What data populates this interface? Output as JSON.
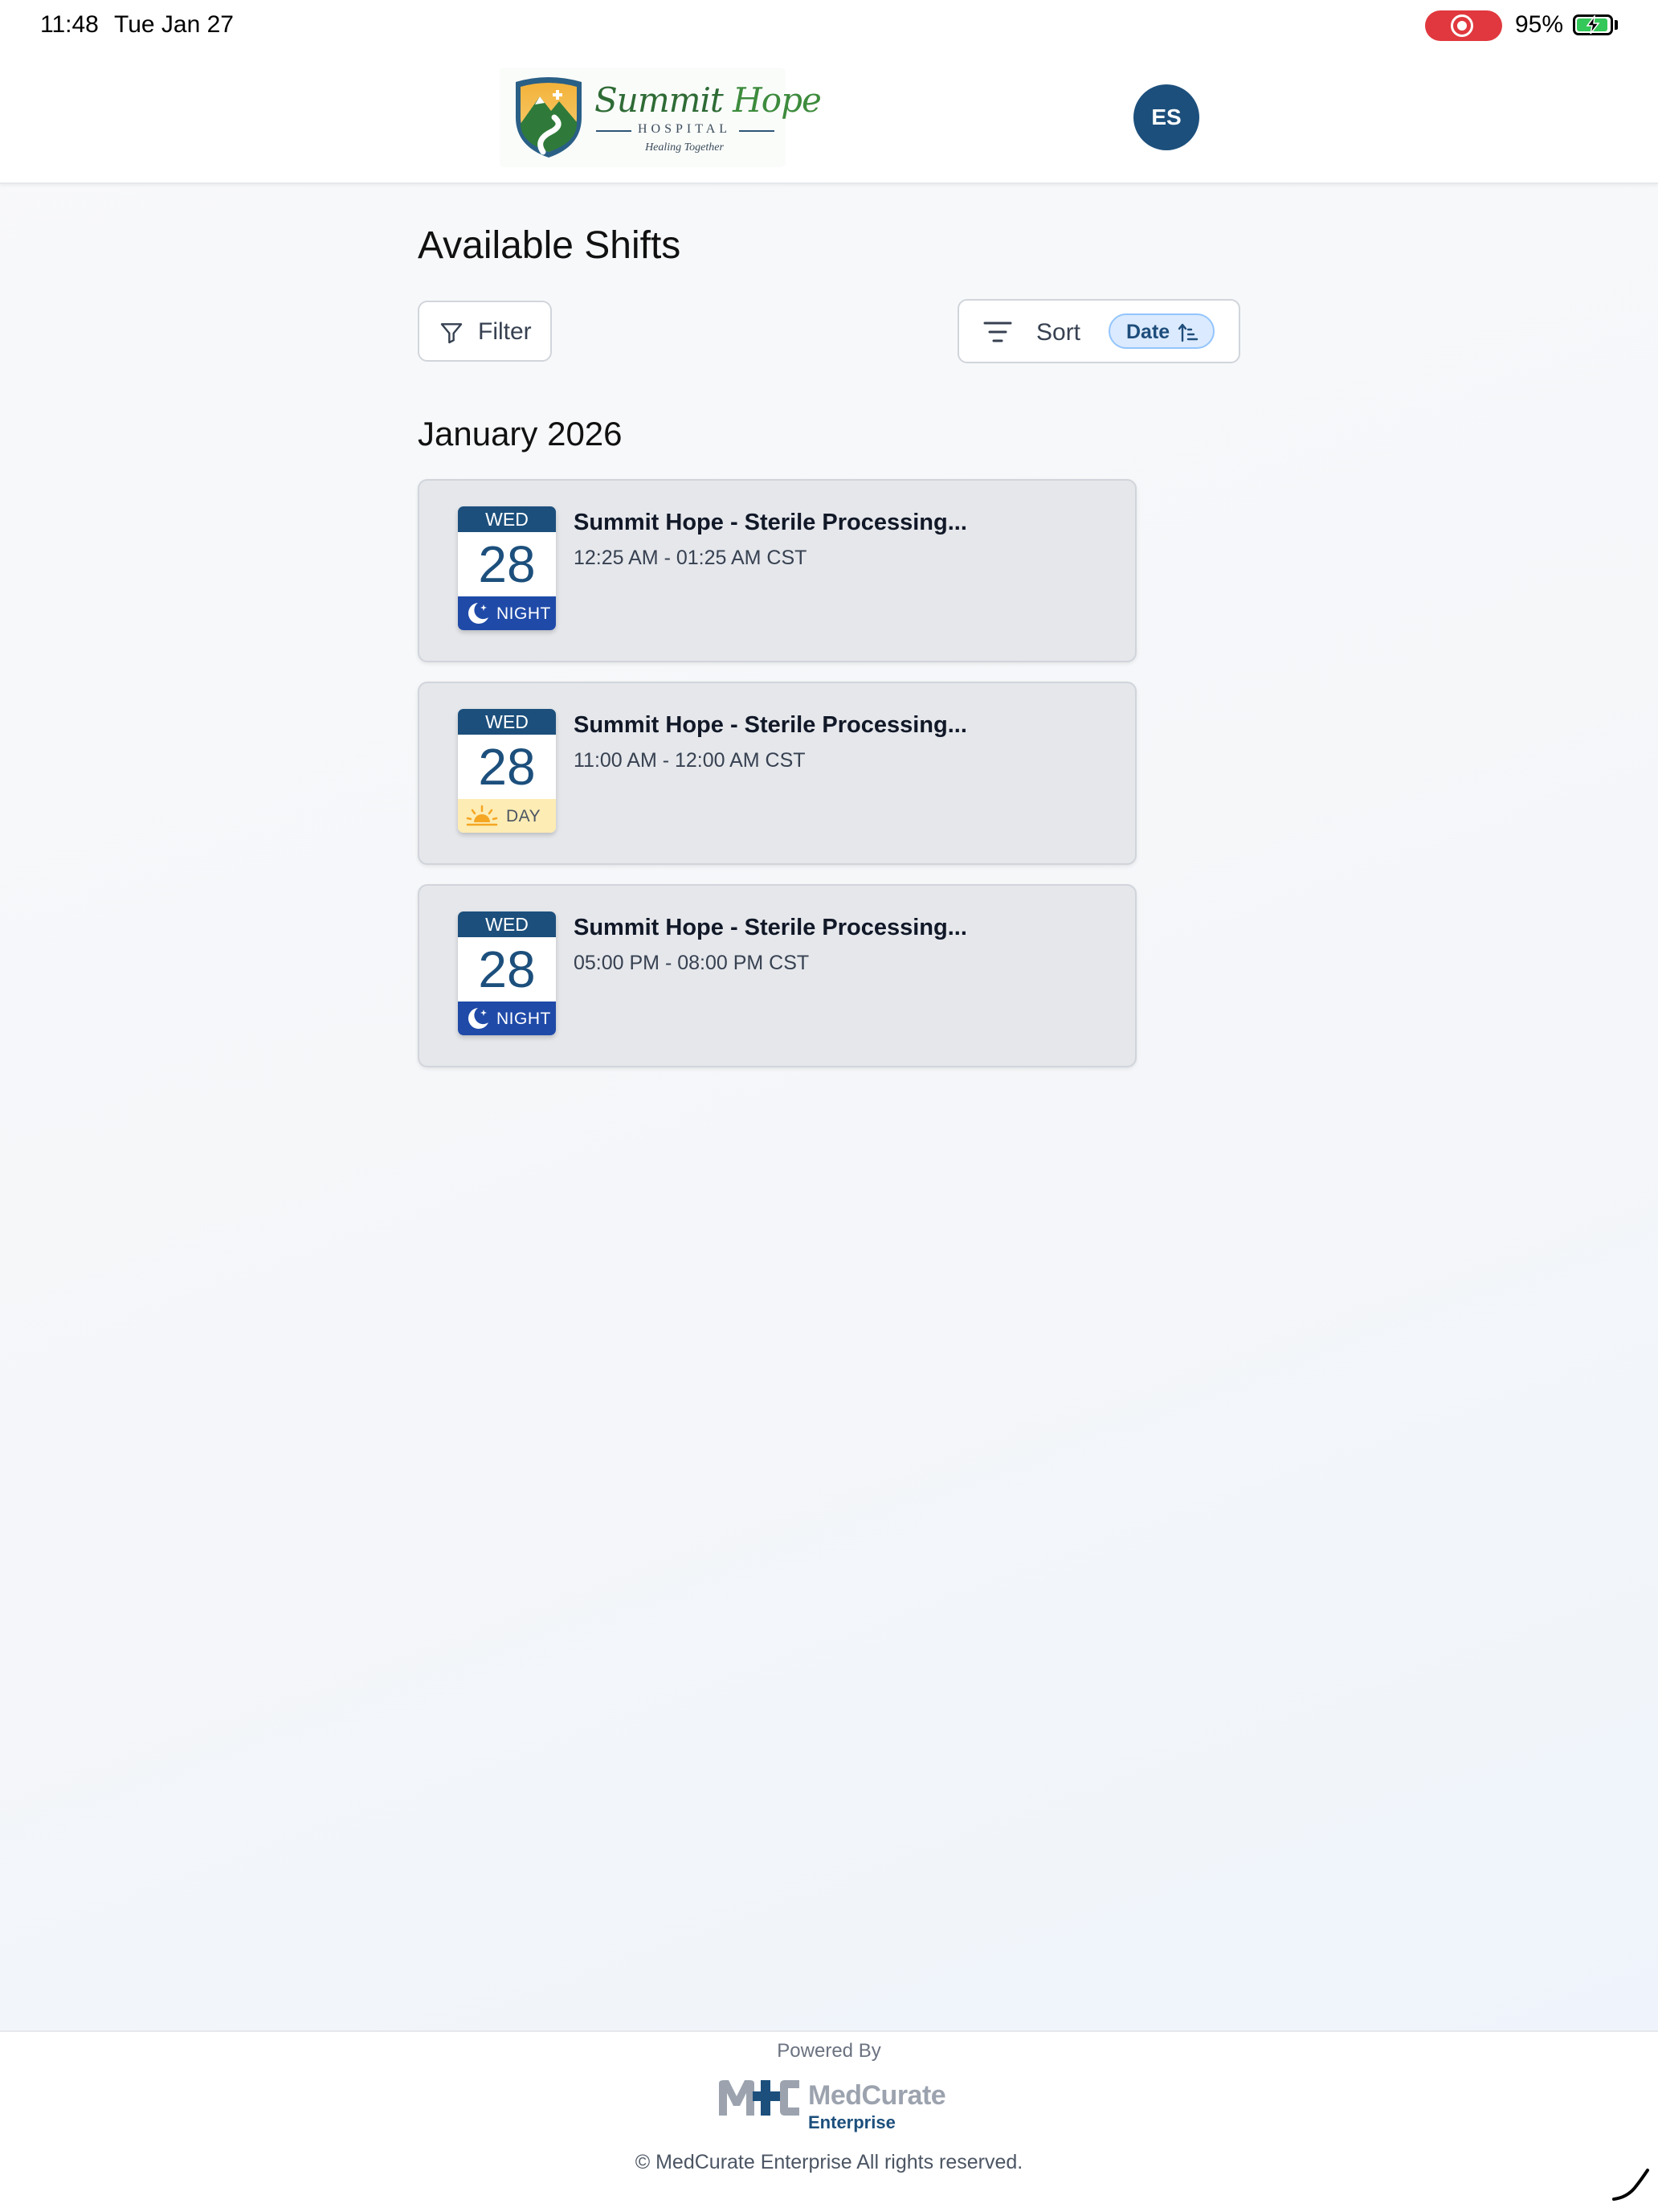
{
  "status_bar": {
    "time": "11:48",
    "date": "Tue Jan 27",
    "battery_percent": "95%",
    "battery_level": 0.95,
    "screen_recording": true
  },
  "header": {
    "logo": {
      "title_part1": "Summit",
      "title_part2": "Hope",
      "subtitle": "HOSPITAL",
      "tagline": "Healing Together"
    },
    "avatar_initials": "ES"
  },
  "main": {
    "title": "Available Shifts",
    "filter_label": "Filter",
    "sort_label": "Sort",
    "sort_value": "Date",
    "sort_direction": "ascending",
    "month_heading": "January 2026",
    "shifts": [
      {
        "weekday": "WED",
        "day": "28",
        "period": "NIGHT",
        "period_icon": "moon-stars-icon",
        "title": "Summit Hope - Sterile Processing...",
        "time": "12:25 AM - 01:25 AM CST"
      },
      {
        "weekday": "WED",
        "day": "28",
        "period": "DAY",
        "period_icon": "sunrise-icon",
        "title": "Summit Hope - Sterile Processing...",
        "time": "11:00 AM - 12:00 AM CST"
      },
      {
        "weekday": "WED",
        "day": "28",
        "period": "NIGHT",
        "period_icon": "moon-stars-icon",
        "title": "Summit Hope - Sterile Processing...",
        "time": "05:00 PM - 08:00 PM CST"
      }
    ]
  },
  "footer": {
    "powered_by": "Powered By",
    "brand_name": "MedCurate",
    "brand_sub": "Enterprise",
    "copyright": "© MedCurate Enterprise All rights reserved."
  },
  "colors": {
    "primary": "#1c4f7c",
    "night_badge": "#1f4aa8",
    "day_badge": "#fdecb4",
    "card_bg": "#e5e7eb",
    "recording": "#e0383e",
    "battery_charging": "#34c759"
  }
}
